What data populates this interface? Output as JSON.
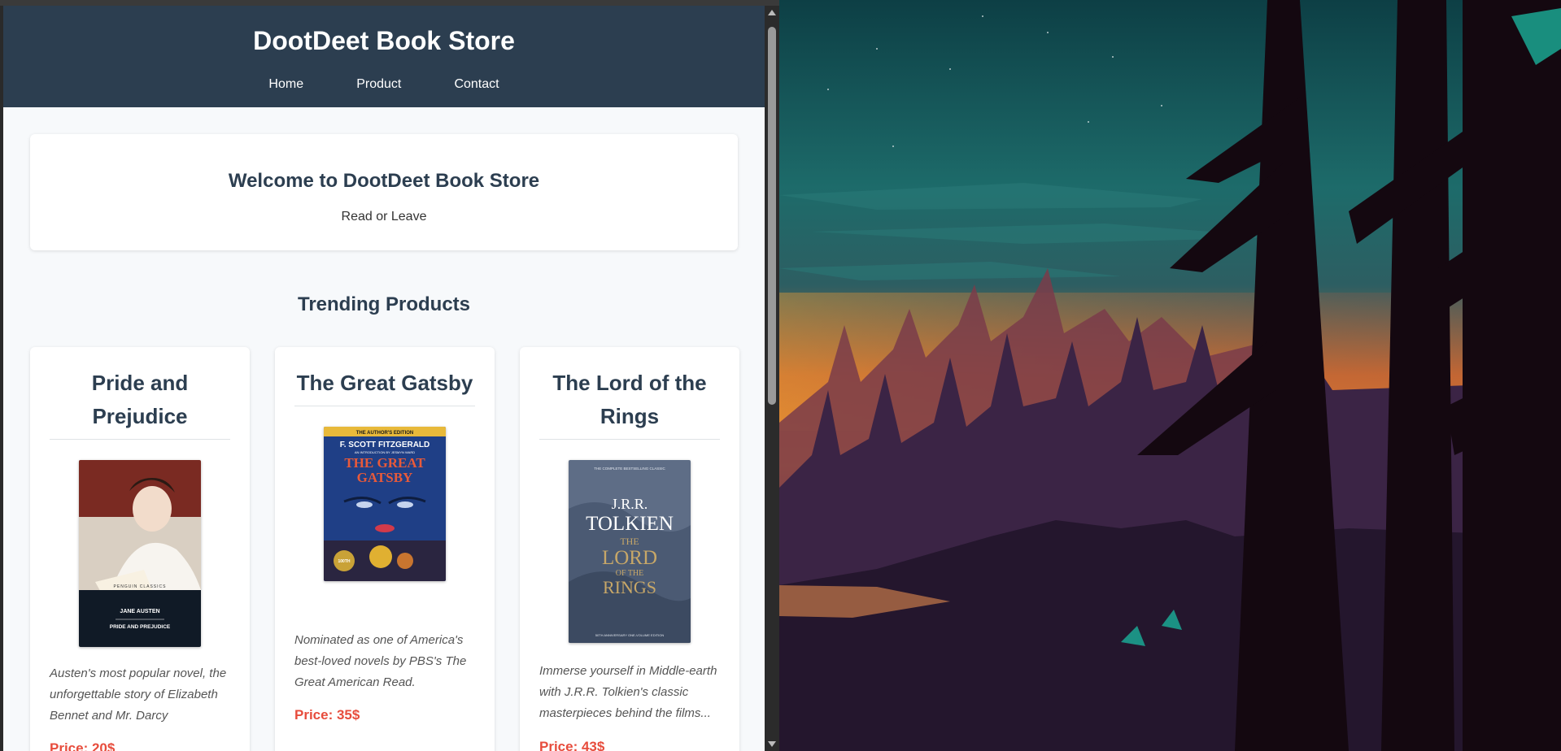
{
  "site": {
    "title": "DootDeet Book Store",
    "nav": [
      "Home",
      "Product",
      "Contact"
    ]
  },
  "welcome": {
    "title": "Welcome to DootDeet Book Store",
    "subtitle": "Read or Leave"
  },
  "trending": {
    "heading": "Trending Products",
    "products": [
      {
        "title": "Pride and Prejudice",
        "description": "Austen's most popular novel, the unforgettable story of Elizabeth Bennet and Mr. Darcy",
        "price": "Price: 20$",
        "cover": {
          "series": "PENGUIN CLASSICS",
          "author": "JANE AUSTEN",
          "title": "PRIDE AND PREJUDICE"
        }
      },
      {
        "title": "The Great Gatsby",
        "description": "Nominated as one of America's best-loved novels by PBS's The Great American Read.",
        "price": "Price: 35$",
        "cover": {
          "banner": "THE AUTHOR'S EDITION",
          "author": "F. SCOTT FITZGERALD",
          "credit": "AN INTRODUCTION BY JESMYN WARD",
          "title_line1": "THE GREAT",
          "title_line2": "GATSBY",
          "badge": "100TH"
        }
      },
      {
        "title": "The Lord of the Rings",
        "description": "Immerse yourself in Middle-earth with J.R.R. Tolkien's classic masterpieces behind the films...",
        "price": "Price: 43$",
        "cover": {
          "tagline": "THE COMPLETE BESTSELLING CLASSIC",
          "author_line1": "J.R.R.",
          "author_line2": "TOLKIEN",
          "title_line1": "THE",
          "title_line2": "LORD",
          "title_line3": "OF THE",
          "title_line4": "RINGS",
          "footer": "50TH ANNIVERSARY ONE-VOLUME EDITION"
        }
      }
    ]
  },
  "colors": {
    "header": "#2c3e50",
    "price": "#e74c3c",
    "page_bg": "#f7f9fb"
  }
}
